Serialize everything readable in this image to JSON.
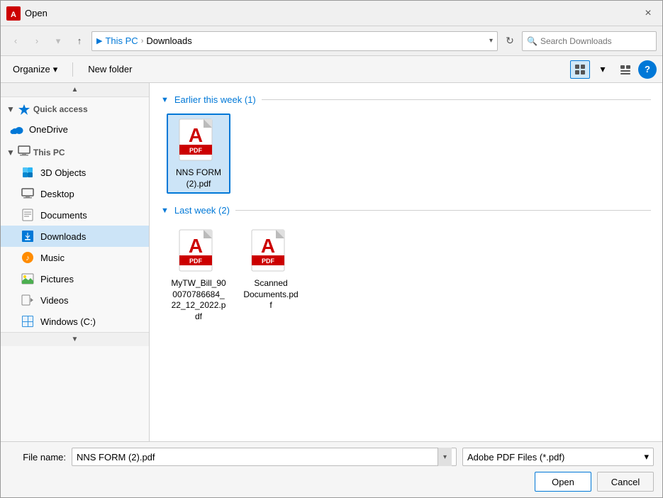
{
  "titleBar": {
    "title": "Open",
    "closeLabel": "×"
  },
  "navBar": {
    "backLabel": "‹",
    "forwardLabel": "›",
    "dropdownLabel": "▾",
    "upLabel": "↑",
    "addressCrumbs": [
      "This PC",
      "Downloads"
    ],
    "refreshLabel": "↻",
    "searchPlaceholder": "Search Downloads"
  },
  "toolbar": {
    "organizeLabel": "Organize",
    "newFolderLabel": "New folder",
    "viewGridLabel": "⊞",
    "viewListLabel": "▤",
    "helpLabel": "?"
  },
  "sidebar": {
    "quickAccess": {
      "header": "Quick access",
      "collapseIcon": "▼"
    },
    "oneDrive": {
      "label": "OneDrive"
    },
    "thisPC": {
      "label": "This PC",
      "items": [
        {
          "label": "3D Objects",
          "icon": "3d"
        },
        {
          "label": "Desktop",
          "icon": "desktop"
        },
        {
          "label": "Documents",
          "icon": "docs"
        },
        {
          "label": "Downloads",
          "icon": "down"
        },
        {
          "label": "Music",
          "icon": "music"
        },
        {
          "label": "Pictures",
          "icon": "pics"
        },
        {
          "label": "Videos",
          "icon": "vid"
        },
        {
          "label": "Windows (C:)",
          "icon": "win"
        }
      ]
    }
  },
  "content": {
    "sections": [
      {
        "label": "Earlier this week (1)",
        "files": [
          {
            "name": "NNS FORM (2).pdf",
            "selected": true
          }
        ]
      },
      {
        "label": "Last week (2)",
        "files": [
          {
            "name": "MyTW_Bill_900070786684_22_12_2022.pdf",
            "selected": false
          },
          {
            "name": "Scanned Documents.pdf",
            "selected": false
          }
        ]
      }
    ]
  },
  "bottomBar": {
    "fileNameLabel": "File name:",
    "fileNameValue": "NNS FORM (2).pdf",
    "fileTypeValue": "Adobe PDF Files (*.pdf)",
    "openLabel": "Open",
    "cancelLabel": "Cancel",
    "dropdownArrow": "▾"
  }
}
